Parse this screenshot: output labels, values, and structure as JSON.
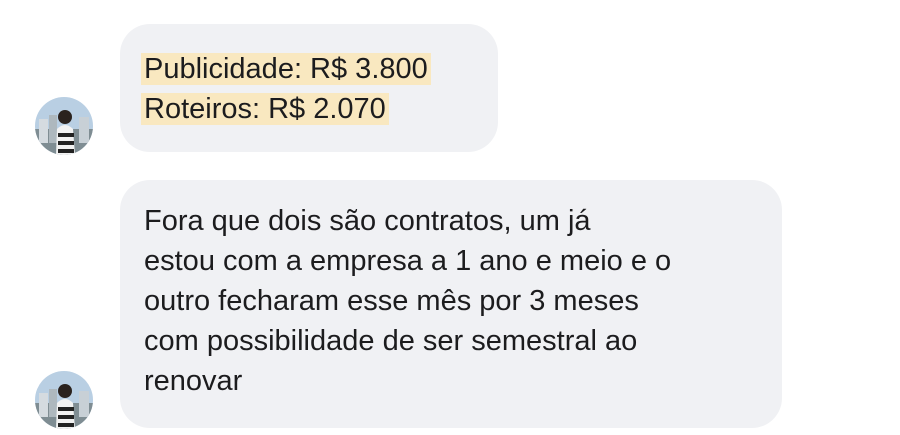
{
  "messages": [
    {
      "lines": [
        "Publicidade: R$ 3.800",
        "Roteiros: R$ 2.070"
      ],
      "highlight_color": "#f9e8c0"
    },
    {
      "lines": [
        "Fora que dois são contratos, um já",
        "estou com a empresa a 1 ano e meio e o",
        "outro fecharam esse mês por 3 meses",
        "com possibilidade de ser semestral ao",
        "renovar"
      ]
    }
  ],
  "colors": {
    "bubble_background": "#f0f1f4",
    "text": "#1c1c1e"
  }
}
